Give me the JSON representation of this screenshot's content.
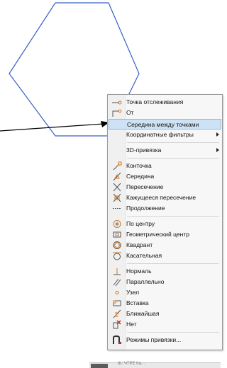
{
  "colors": {
    "shape": "#3a5fc8",
    "highlight": "#cde3f5",
    "icon_orange": "#d9731a"
  },
  "menu": {
    "items": [
      {
        "label": "Точка отслеживания",
        "icon": "tracking-point-icon"
      },
      {
        "label": "От",
        "icon": "from-icon"
      },
      {
        "label": "Середина между точками",
        "icon": "midpoint-between-icon",
        "highlighted": true
      },
      {
        "label": "Координатные фильтры",
        "icon": "coordinate-filters-icon",
        "submenu": true
      },
      {
        "label": "3D-привязка",
        "icon": "3d-snap-icon",
        "submenu": true
      },
      {
        "label": "Конточка",
        "icon": "endpoint-icon"
      },
      {
        "label": "Середина",
        "icon": "midpoint-icon"
      },
      {
        "label": "Пересечение",
        "icon": "intersection-icon"
      },
      {
        "label": "Кажущееся пересечение",
        "icon": "apparent-intersection-icon"
      },
      {
        "label": "Продолжение",
        "icon": "extension-icon"
      },
      {
        "label": "По центру",
        "icon": "center-icon"
      },
      {
        "label": "Геометрический центр",
        "icon": "geometric-center-icon"
      },
      {
        "label": "Квадрант",
        "icon": "quadrant-icon"
      },
      {
        "label": "Касательная",
        "icon": "tangent-icon"
      },
      {
        "label": "Нормаль",
        "icon": "perpendicular-icon"
      },
      {
        "label": "Параллельно",
        "icon": "parallel-icon"
      },
      {
        "label": "Узел",
        "icon": "node-icon"
      },
      {
        "label": "Вставка",
        "icon": "insert-icon"
      },
      {
        "label": "Ближайшая",
        "icon": "nearest-icon"
      },
      {
        "label": "Нет",
        "icon": "none-icon"
      },
      {
        "label": "Режимы привязки...",
        "icon": "osnap-settings-icon"
      }
    ]
  },
  "taskbar": {
    "text": "Ш: ЧТРЕ Ка..."
  }
}
